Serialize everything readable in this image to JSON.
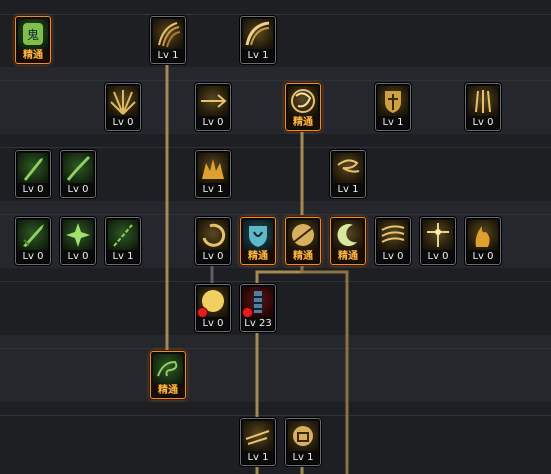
{
  "skills": [
    {
      "id": "s01",
      "icon": "ghost-icon",
      "level": "精通",
      "mastered": true,
      "tone": "green"
    },
    {
      "id": "s02",
      "icon": "claw-slash-icon",
      "level": "Lv 1",
      "mastered": false,
      "tone": "gold"
    },
    {
      "id": "s03",
      "icon": "fan-slash-icon",
      "level": "Lv 1",
      "mastered": false,
      "tone": "gold"
    },
    {
      "id": "s04",
      "icon": "burst-rays-icon",
      "level": "Lv 0",
      "mastered": false,
      "tone": "gold"
    },
    {
      "id": "s05",
      "icon": "thrust-arrow-icon",
      "level": "Lv 0",
      "mastered": false,
      "tone": "gold"
    },
    {
      "id": "s06",
      "icon": "whirl-blade-icon",
      "level": "精通",
      "mastered": true,
      "tone": "gold"
    },
    {
      "id": "s07",
      "icon": "cross-shield-icon",
      "level": "Lv 1",
      "mastered": false,
      "tone": "gold"
    },
    {
      "id": "s08",
      "icon": "triple-strike-icon",
      "level": "Lv 0",
      "mastered": false,
      "tone": "gold"
    },
    {
      "id": "s09",
      "icon": "blade-up-icon",
      "level": "Lv 0",
      "mastered": false,
      "tone": "green"
    },
    {
      "id": "s10",
      "icon": "blade-diagonal-icon",
      "level": "Lv 0",
      "mastered": false,
      "tone": "green"
    },
    {
      "id": "s11",
      "icon": "flame-crown-icon",
      "level": "Lv 1",
      "mastered": false,
      "tone": "gold"
    },
    {
      "id": "s12",
      "icon": "spiral-wind-icon",
      "level": "Lv 1",
      "mastered": false,
      "tone": "gold"
    },
    {
      "id": "s13",
      "icon": "sword-icon",
      "level": "Lv 0",
      "mastered": false,
      "tone": "green"
    },
    {
      "id": "s14",
      "icon": "spark-burst-icon",
      "level": "Lv 0",
      "mastered": false,
      "tone": "green"
    },
    {
      "id": "s15",
      "icon": "chain-slash-icon",
      "level": "Lv 1",
      "mastered": false,
      "tone": "green"
    },
    {
      "id": "s16",
      "icon": "crescent-spin-icon",
      "level": "Lv 0",
      "mastered": false,
      "tone": "gold"
    },
    {
      "id": "s17",
      "icon": "shield-heart-icon",
      "level": "精通",
      "mastered": true,
      "tone": "cyan"
    },
    {
      "id": "s18",
      "icon": "sphere-slash-icon",
      "level": "精通",
      "mastered": true,
      "tone": "gold"
    },
    {
      "id": "s19",
      "icon": "moon-icon",
      "level": "精通",
      "mastered": true,
      "tone": "gold"
    },
    {
      "id": "s20",
      "icon": "gale-icon",
      "level": "Lv 0",
      "mastered": false,
      "tone": "gold"
    },
    {
      "id": "s21",
      "icon": "star-cross-icon",
      "level": "Lv 0",
      "mastered": false,
      "tone": "gold"
    },
    {
      "id": "s22",
      "icon": "rising-flame-icon",
      "level": "Lv 0",
      "mastered": false,
      "tone": "gold"
    },
    {
      "id": "s23",
      "icon": "sun-orb-icon",
      "level": "Lv 0",
      "mastered": false,
      "tone": "gold",
      "locked": true
    },
    {
      "id": "s24",
      "icon": "totem-icon",
      "level": "Lv 23",
      "mastered": false,
      "tone": "red",
      "locked": true
    },
    {
      "id": "s25",
      "icon": "wind-vortex-icon",
      "level": "精通",
      "mastered": true,
      "tone": "green"
    },
    {
      "id": "s26",
      "icon": "dash-slash-icon",
      "level": "Lv 1",
      "mastered": false,
      "tone": "gold"
    },
    {
      "id": "s27",
      "icon": "fist-orb-icon",
      "level": "Lv 1",
      "mastered": false,
      "tone": "gold"
    }
  ],
  "colors": {
    "connector": "#a68a54",
    "mastered_border": "#f08a2a",
    "mastered_text": "#ffb845",
    "level_text": "#f2f2f2"
  }
}
